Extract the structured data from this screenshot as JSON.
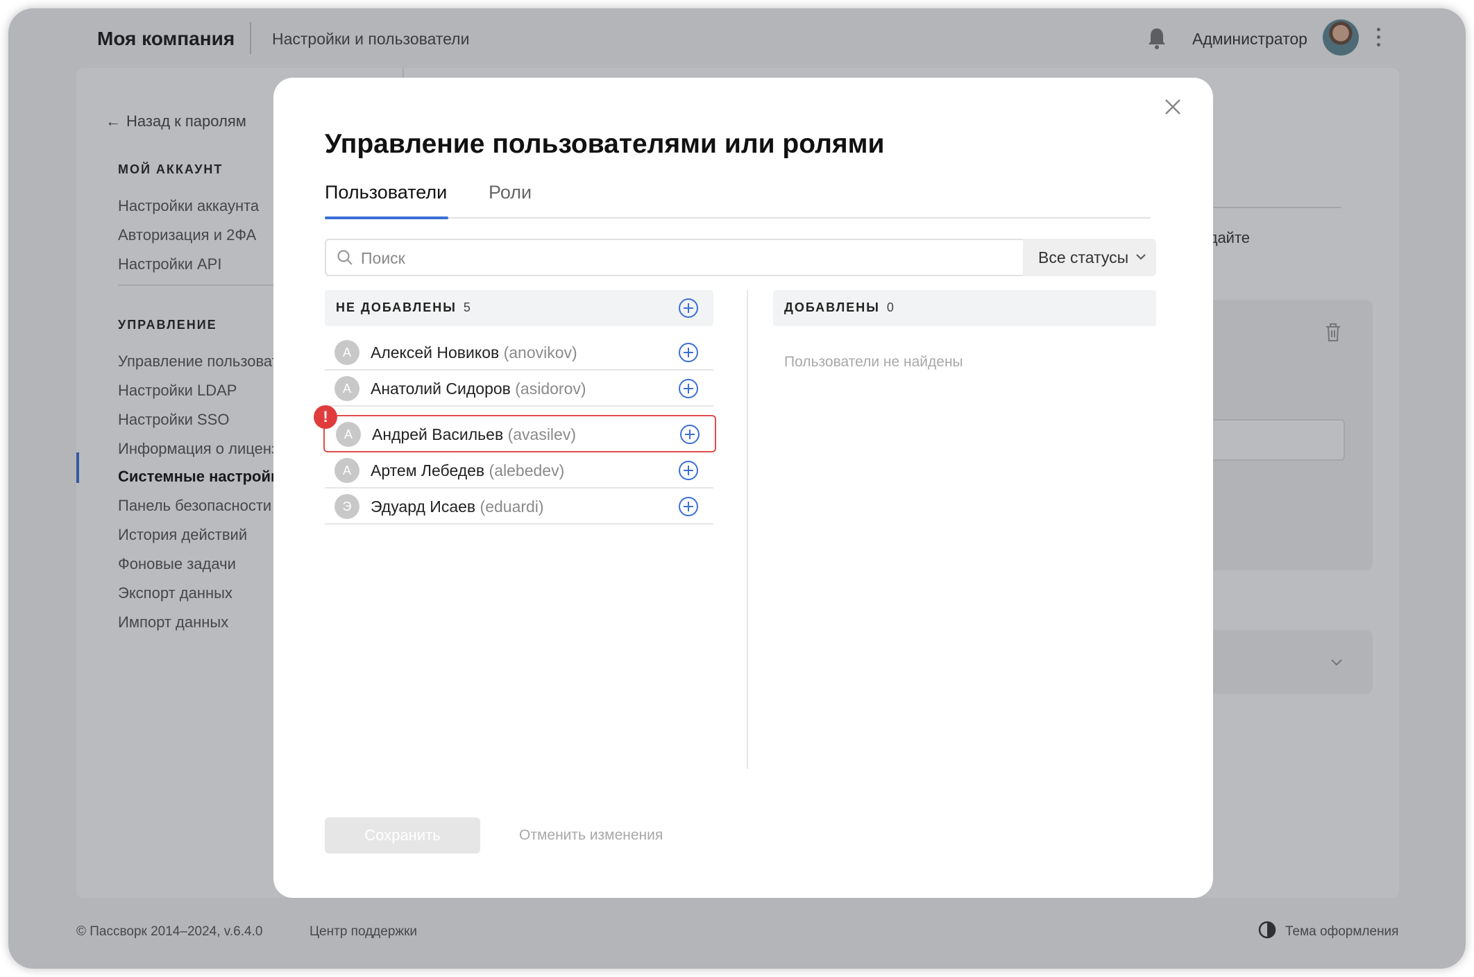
{
  "header": {
    "company": "Моя компания",
    "breadcrumb": "Настройки и пользователи",
    "user_name": "Администратор"
  },
  "sidebar": {
    "back_link": "Назад к паролям",
    "section_account": "МОЙ АККАУНТ",
    "account_items": [
      {
        "label": "Настройки аккаунта"
      },
      {
        "label": "Авторизация и 2ФА"
      },
      {
        "label": "Настройки API"
      }
    ],
    "section_management": "УПРАВЛЕНИЕ",
    "management_items": [
      {
        "label": "Управление пользователями"
      },
      {
        "label": "Настройки LDAP"
      },
      {
        "label": "Настройки SSO"
      },
      {
        "label": "Информация о лицензии"
      },
      {
        "label": "Системные настройки",
        "active": true
      },
      {
        "label": "Панель безопасности"
      },
      {
        "label": "История действий"
      },
      {
        "label": "Фоновые задачи"
      },
      {
        "label": "Экспорт данных"
      },
      {
        "label": "Импорт данных"
      }
    ]
  },
  "background": {
    "partial_text": "здайте"
  },
  "footer": {
    "copyright": "© Пассворк 2014–2024, v.6.4.0",
    "support": "Центр поддержки",
    "theme": "Тема оформления"
  },
  "modal": {
    "title": "Управление пользователями или ролями",
    "tabs": [
      {
        "label": "Пользователи",
        "active": true
      },
      {
        "label": "Роли",
        "active": false
      }
    ],
    "search_placeholder": "Поиск",
    "status_filter": "Все статусы",
    "not_added": {
      "label": "НЕ ДОБАВЛЕНЫ",
      "count": "5",
      "users": [
        {
          "initial": "А",
          "name": "Алексей Новиков",
          "login": "(anovikov)",
          "error": false
        },
        {
          "initial": "А",
          "name": "Анатолий Сидоров",
          "login": "(asidorov)",
          "error": false
        },
        {
          "initial": "А",
          "name": "Андрей Васильев",
          "login": "(avasilev)",
          "error": true
        },
        {
          "initial": "А",
          "name": "Артем Лебедев",
          "login": "(alebedev)",
          "error": false
        },
        {
          "initial": "Э",
          "name": "Эдуард Исаев",
          "login": "(eduardi)",
          "error": false
        }
      ]
    },
    "added": {
      "label": "ДОБАВЛЕНЫ",
      "count": "0",
      "empty_message": "Пользователи не найдены"
    },
    "save_label": "Сохранить",
    "cancel_label": "Отменить изменения"
  },
  "colors": {
    "accent": "#3b6fd6",
    "error": "#e03c3c"
  }
}
